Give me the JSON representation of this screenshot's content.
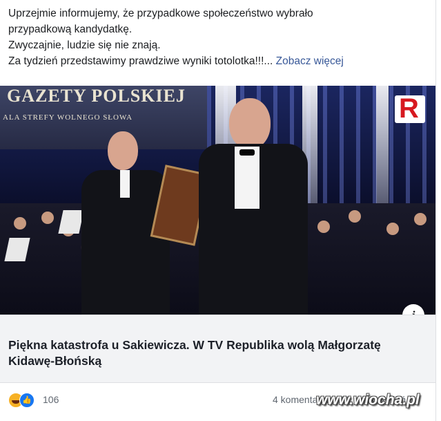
{
  "post": {
    "text_lines": [
      "Uprzejmie informujemy, że przypadkowe społeczeństwo wybrało",
      "przypadkową kandydatkę.",
      "Zwyczajnie, ludzie się nie znają."
    ],
    "text_last_line": "Za tydzień przedstawimy prawdziwe wyniki totolotka!!!...",
    "see_more_label": "Zobacz więcej"
  },
  "media": {
    "screen_title": "GAZETY POLSKIEJ",
    "screen_subtitle": "ALA STREFY WOLNEGO SŁOWA",
    "channel_logo_letter": "R",
    "channel_logo_color": "#d71920",
    "info_icon": "i"
  },
  "link_preview": {
    "title": "Piękna katastrofa u Sakiewicza. W TV Republika wolą Małgorzatę Kidawę-Błońską"
  },
  "footer": {
    "reactions": [
      "haha-icon",
      "like-icon"
    ],
    "reaction_count": "106",
    "comments_label": "4 komentarze · 16 udostępnień"
  },
  "watermark": "www.wiocha.pl"
}
